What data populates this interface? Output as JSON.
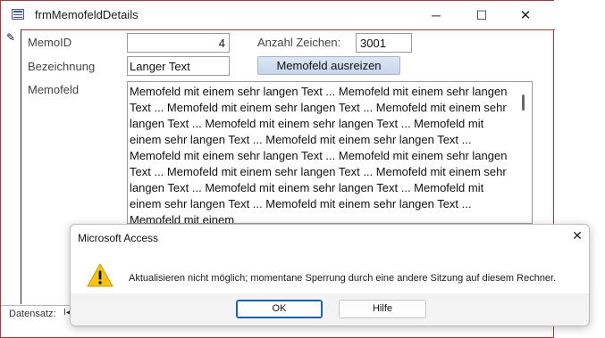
{
  "form": {
    "title": "frmMemofeldDetails",
    "window_buttons": {
      "minimize": "─",
      "maximize": "☐",
      "close": "✕"
    },
    "record_indicator": "✎",
    "memoid_label": "MemoID",
    "memoid_value": "4",
    "anzahl_label": "Anzahl Zeichen:",
    "anzahl_value": "3001",
    "bezeichnung_label": "Bezeichnung",
    "bezeichnung_value": "Langer Text",
    "ausreizen_button": "Memofeld ausreizen",
    "memofeld_label": "Memofeld",
    "memofeld_value": " Memofeld mit einem sehr langen Text ... Memofeld mit einem sehr langen Text ... Memofeld mit einem sehr langen Text ... Memofeld mit einem sehr langen Text ... Memofeld mit einem sehr langen Text ... Memofeld mit einem sehr langen Text ... Memofeld mit einem sehr langen Text ... Memofeld mit einem sehr langen Text ... Memofeld mit einem sehr langen Text ... Memofeld mit einem sehr langen Text ... Memofeld mit einem sehr langen Text ... Memofeld mit einem sehr langen Text ... Memofeld mit einem sehr langen Text ... Memofeld mit einem sehr langen Text ... Memofeld mit einem",
    "nav_label": "Datensatz:",
    "nav_first": "I◀"
  },
  "dialog": {
    "title": "Microsoft Access",
    "close": "✕",
    "message": "Aktualisieren nicht möglich; momentane Sperrung durch eine andere Sitzung auf diesem Rechner.",
    "ok_label": "OK",
    "hilfe_label": "Hilfe"
  },
  "colors": {
    "window_border": "#a33a3a",
    "button_accent": "#1e5fb4",
    "warning_yellow": "#f7c21a"
  }
}
